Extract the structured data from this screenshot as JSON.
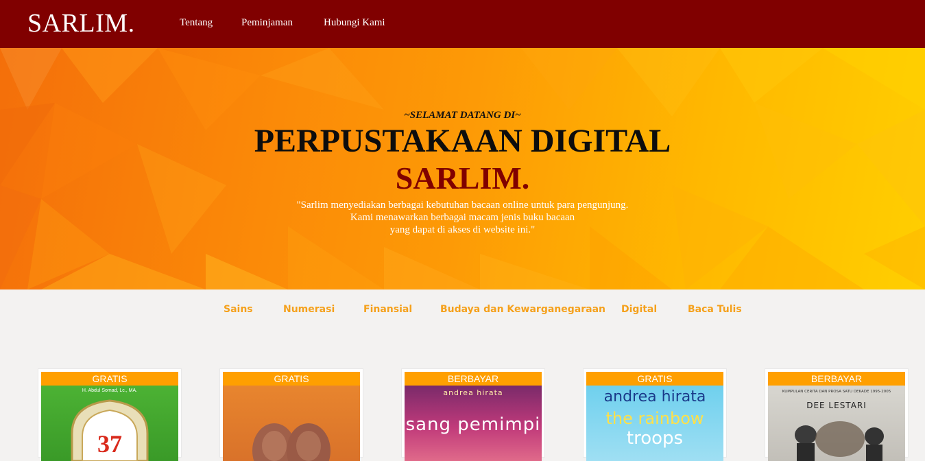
{
  "navbar": {
    "brand": "SARLIM.",
    "links": [
      "Tentang",
      "Peminjaman",
      "Hubungi Kami"
    ]
  },
  "hero": {
    "greeting": "~SELAMAT DATANG DI~",
    "title": "PERPUSTAKAAN DIGITAL",
    "brand": "SARLIM.",
    "description": [
      "\"Sarlim menyediakan berbagai kebutuhan bacaan online untuk para pengunjung.",
      "Kami menawarkan berbagai macam jenis buku bacaan",
      "yang dapat di akses di website ini.\""
    ]
  },
  "categories": [
    "Sains",
    "Numerasi",
    "Finansial",
    "Budaya dan Kewarganegaraan",
    "Digital",
    "Baca Tulis"
  ],
  "books": [
    {
      "badge": "GRATIS",
      "cover_author": "H. Abdul Somad, Lc., MA.",
      "cover_number": "37"
    },
    {
      "badge": "GRATIS"
    },
    {
      "badge": "BERBAYAR",
      "cover_author": "andrea hirata",
      "cover_title": "sang pemimpi"
    },
    {
      "badge": "GRATIS",
      "cover_author": "andrea hirata",
      "cover_title_line1": "the rainbow",
      "cover_title_line2": "troops"
    },
    {
      "badge": "BERBAYAR",
      "cover_subtitle": "KUMPULAN CERITA DAN PROSA SATU DEKADE 1995-2005",
      "cover_author": "DEE LESTARI"
    }
  ],
  "colors": {
    "navbar": "#800000",
    "accent_orange": "#ff9f00",
    "category_text": "#f5a11c",
    "page_bg": "#f3f2f1"
  }
}
